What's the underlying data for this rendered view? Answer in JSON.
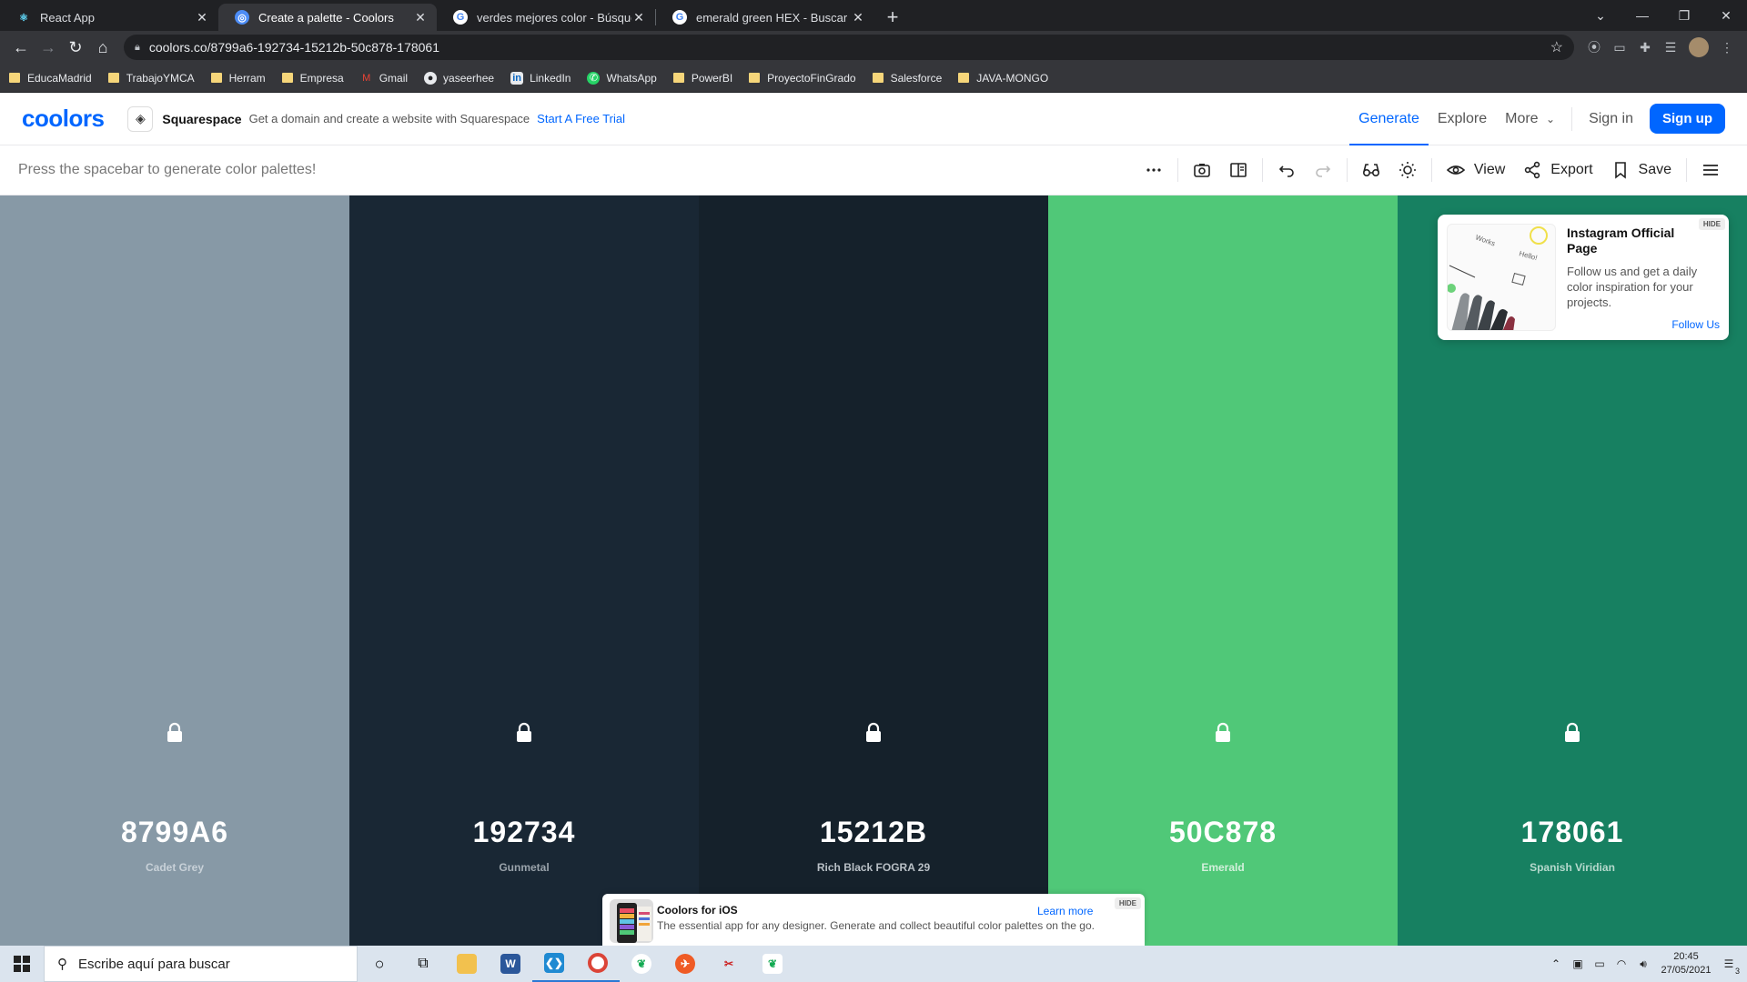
{
  "browser": {
    "tabs": [
      {
        "title": "React App",
        "active": false,
        "favicon": "react-icon"
      },
      {
        "title": "Create a palette - Coolors",
        "active": true,
        "favicon": "chrome-globe-icon"
      },
      {
        "title": "verdes mejores color - Búsqueda",
        "active": false,
        "favicon": "google-icon"
      },
      {
        "title": "emerald green HEX - Buscar con",
        "active": false,
        "favicon": "google-icon"
      }
    ],
    "new_tab": "+",
    "url": "coolors.co/8799a6-192734-15212b-50c878-178061",
    "bookmarks": [
      {
        "label": "EducaMadrid",
        "icon": "folder-icon"
      },
      {
        "label": "TrabajoYMCA",
        "icon": "folder-icon"
      },
      {
        "label": "Herram",
        "icon": "folder-icon"
      },
      {
        "label": "Empresa",
        "icon": "folder-icon"
      },
      {
        "label": "Gmail",
        "icon": "gmail-icon"
      },
      {
        "label": "yaseerhee",
        "icon": "github-icon"
      },
      {
        "label": "LinkedIn",
        "icon": "linkedin-icon"
      },
      {
        "label": "WhatsApp",
        "icon": "whatsapp-icon"
      },
      {
        "label": "PowerBI",
        "icon": "folder-icon"
      },
      {
        "label": "ProyectoFinGrado",
        "icon": "folder-icon"
      },
      {
        "label": "Salesforce",
        "icon": "folder-icon"
      },
      {
        "label": "JAVA-MONGO",
        "icon": "folder-icon"
      }
    ]
  },
  "header": {
    "logo": "coolors",
    "ad": {
      "brand": "Squarespace",
      "text": "Get a domain and create a website with Squarespace",
      "cta": "Start A Free Trial"
    },
    "nav": {
      "generate": "Generate",
      "explore": "Explore",
      "more": "More",
      "sign_in": "Sign in",
      "sign_up": "Sign up"
    }
  },
  "toolbar": {
    "hint": "Press the spacebar to generate color palettes!",
    "view": "View",
    "export": "Export",
    "save": "Save"
  },
  "palette": [
    {
      "hex": "8799A6",
      "name": "Cadet Grey",
      "color": "#8799A6",
      "text_color": "#ffffff",
      "name_color": "#c8d1d8"
    },
    {
      "hex": "192734",
      "name": "Gunmetal",
      "color": "#192734",
      "text_color": "#ffffff",
      "name_color": "#9aa3ab"
    },
    {
      "hex": "15212B",
      "name": "Rich Black FOGRA 29",
      "color": "#15212B",
      "text_color": "#ffffff",
      "name_color": "#b9c0c6"
    },
    {
      "hex": "50C878",
      "name": "Emerald",
      "color": "#50C878",
      "text_color": "#ffffff",
      "name_color": "#d3f0dc"
    },
    {
      "hex": "178061",
      "name": "Spanish Viridian",
      "color": "#178061",
      "text_color": "#ffffff",
      "name_color": "#b6d9cd"
    }
  ],
  "instagram_card": {
    "title": "Instagram Official Page",
    "text": "Follow us and get a daily color inspiration for your projects.",
    "link": "Follow Us",
    "hide": "HIDE",
    "image_words": [
      "Works",
      "Hello!"
    ]
  },
  "ios_banner": {
    "title": "Coolors for iOS",
    "text": "The essential app for any designer. Generate and collect beautiful color palettes on the go.",
    "link": "Learn more",
    "hide": "HIDE"
  },
  "taskbar": {
    "search_placeholder": "Escribe aquí para buscar",
    "time": "20:45",
    "date": "27/05/2021",
    "notifications": "3"
  },
  "colors": {
    "accent": "#0066ff"
  }
}
